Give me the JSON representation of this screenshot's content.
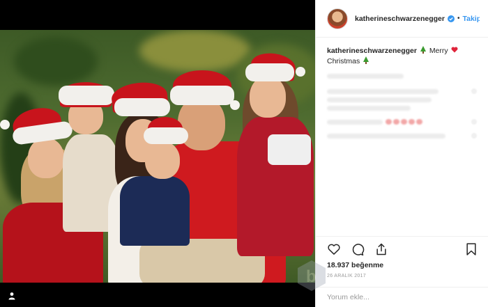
{
  "post": {
    "username": "katherineschwarzenegger",
    "follow_label": "Takip E",
    "caption_user": "katherineschwarzenegger",
    "caption_text": "Merry Christmas"
  },
  "engagement": {
    "likes": "18.937 beğenme",
    "date": "26 ARALIK 2017"
  },
  "comment_box": {
    "placeholder": "Yorum ekle..."
  },
  "icons": {
    "verified": "verified-badge-icon",
    "heart": "heart-icon",
    "comment": "comment-icon",
    "share": "share-icon",
    "bookmark": "bookmark-icon",
    "user_tag": "user-tag-icon",
    "tree": "christmas-tree-emoji",
    "red_heart": "red-heart-emoji"
  },
  "colors": {
    "link_blue": "#3897f0",
    "text": "#262626",
    "muted": "#999999",
    "hat_red": "#c8141c"
  }
}
